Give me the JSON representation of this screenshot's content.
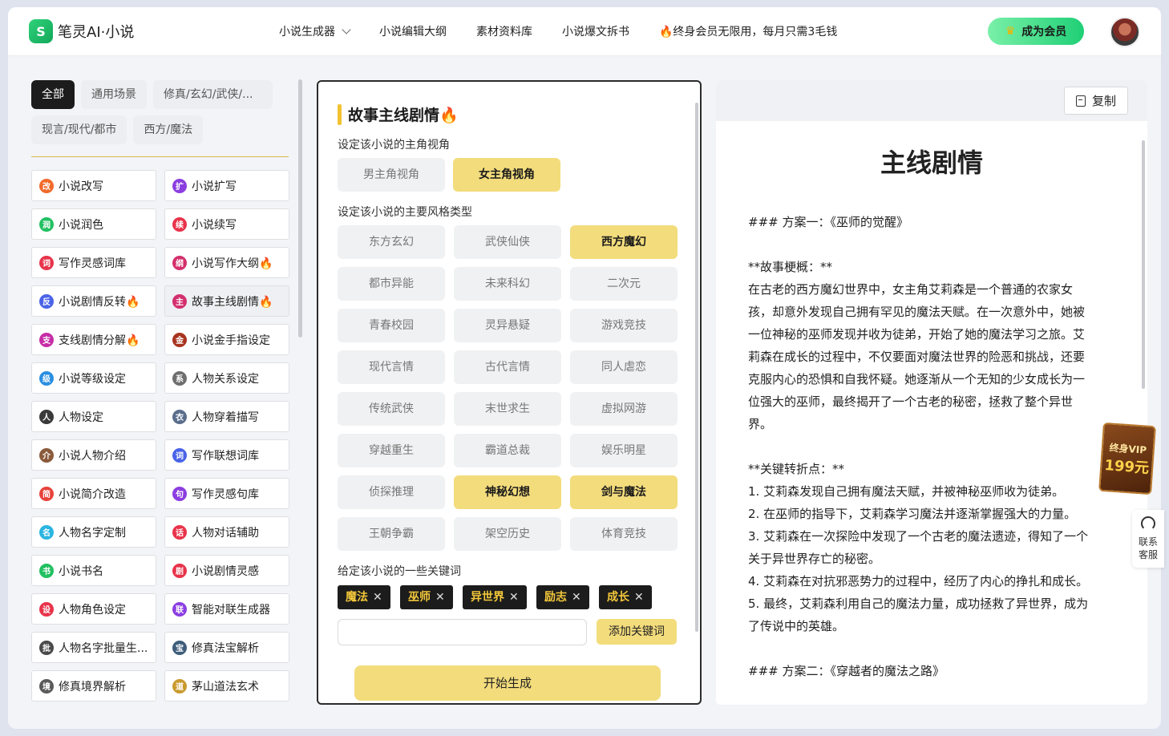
{
  "brand": {
    "name": "笔灵AI·小说",
    "mark": "S"
  },
  "nav": [
    {
      "label": "小说生成器",
      "has_dropdown": true
    },
    {
      "label": "小说编辑大纲"
    },
    {
      "label": "素材资料库"
    },
    {
      "label": "小说爆文拆书"
    },
    {
      "label": "🔥终身会员无限用，每月只需3毛钱"
    }
  ],
  "vip_button": {
    "label": "成为会员",
    "icon": "crown-icon"
  },
  "filters": {
    "row1": [
      "全部",
      "通用场景",
      "修真/玄幻/武侠/..."
    ],
    "row2": [
      "现言/现代/都市",
      "西方/魔法"
    ],
    "active": "全部"
  },
  "tools": [
    {
      "label": "小说改写",
      "icon": "改",
      "color": "#f06a2a"
    },
    {
      "label": "小说扩写",
      "icon": "扩",
      "color": "#8b3ee0"
    },
    {
      "label": "小说润色",
      "icon": "润",
      "color": "#22c061"
    },
    {
      "label": "小说续写",
      "icon": "续",
      "color": "#e8334a"
    },
    {
      "label": "写作灵感词库",
      "icon": "词",
      "color": "#e8334a"
    },
    {
      "label": "小说写作大纲🔥",
      "icon": "纲",
      "color": "#d4306b"
    },
    {
      "label": "小说剧情反转🔥",
      "icon": "反",
      "color": "#4a63e8"
    },
    {
      "label": "故事主线剧情🔥",
      "icon": "主",
      "color": "#d32f6f"
    },
    {
      "label": "支线剧情分解🔥",
      "icon": "支",
      "color": "#c62da6"
    },
    {
      "label": "小说金手指设定",
      "icon": "金",
      "color": "#a8341f"
    },
    {
      "label": "小说等级设定",
      "icon": "级",
      "color": "#2b8fe0"
    },
    {
      "label": "人物关系设定",
      "icon": "系",
      "color": "#6e6e6e"
    },
    {
      "label": "人物设定",
      "icon": "人",
      "color": "#3a3a3a"
    },
    {
      "label": "人物穿着描写",
      "icon": "衣",
      "color": "#5a6e8c"
    },
    {
      "label": "小说人物介绍",
      "icon": "介",
      "color": "#8a5a3a"
    },
    {
      "label": "写作联想词库",
      "icon": "词",
      "color": "#4a63e8"
    },
    {
      "label": "小说简介改造",
      "icon": "简",
      "color": "#e8433a"
    },
    {
      "label": "写作灵感句库",
      "icon": "句",
      "color": "#8b3ee0"
    },
    {
      "label": "人物名字定制",
      "icon": "名",
      "color": "#2bb5e0"
    },
    {
      "label": "人物对话辅助",
      "icon": "话",
      "color": "#e8334a"
    },
    {
      "label": "小说书名",
      "icon": "书",
      "color": "#22c061"
    },
    {
      "label": "小说剧情灵感",
      "icon": "剧",
      "color": "#e8334a"
    },
    {
      "label": "人物角色设定",
      "icon": "设",
      "color": "#e8334a"
    },
    {
      "label": "智能对联生成器",
      "icon": "联",
      "color": "#8b3ee0"
    },
    {
      "label": "人物名字批量生...",
      "icon": "批",
      "color": "#4a4a4a"
    },
    {
      "label": "修真法宝解析",
      "icon": "宝",
      "color": "#3d5d7a"
    },
    {
      "label": "修真境界解析",
      "icon": "境",
      "color": "#5a5a5a"
    },
    {
      "label": "茅山道法玄术",
      "icon": "道",
      "color": "#c99a2e"
    }
  ],
  "selected_tool": "故事主线剧情🔥",
  "panel": {
    "title": "故事主线剧情🔥",
    "pov_label": "设定该小说的主角视角",
    "pov_options": [
      "男主角视角",
      "女主角视角"
    ],
    "pov_selected": "女主角视角",
    "style_label": "设定该小说的主要风格类型",
    "styles": [
      "东方玄幻",
      "武侠仙侠",
      "西方魔幻",
      "都市异能",
      "未来科幻",
      "二次元",
      "青春校园",
      "灵异悬疑",
      "游戏竞技",
      "现代言情",
      "古代言情",
      "同人虐恋",
      "传统武侠",
      "末世求生",
      "虚拟网游",
      "穿越重生",
      "霸道总裁",
      "娱乐明星",
      "侦探推理",
      "神秘幻想",
      "剑与魔法",
      "王朝争霸",
      "架空历史",
      "体育竞技"
    ],
    "styles_selected": [
      "西方魔幻",
      "神秘幻想",
      "剑与魔法"
    ],
    "keyword_label": "给定该小说的一些关键词",
    "keywords": [
      "魔法",
      "巫师",
      "异世界",
      "励志",
      "成长"
    ],
    "keyword_input_placeholder": "",
    "add_keyword_label": "添加关键词",
    "generate_label": "开始生成"
  },
  "result": {
    "copy_label": "复制",
    "title": "主线剧情",
    "lines": [
      "### 方案一：《巫师的觉醒》",
      "",
      "**故事梗概：**",
      "在古老的西方魔幻世界中，女主角艾莉森是一个普通的农家女",
      "孩，却意外发现自己拥有罕见的魔法天赋。在一次意外中，她被",
      "一位神秘的巫师发现并收为徒弟，开始了她的魔法学习之旅。艾",
      "莉森在成长的过程中，不仅要面对魔法世界的险恶和挑战，还要",
      "克服内心的恐惧和自我怀疑。她逐渐从一个无知的少女成长为一",
      "位强大的巫师，最终揭开了一个古老的秘密，拯救了整个异世",
      "界。",
      "",
      "**关键转折点：**",
      "1. 艾莉森发现自己拥有魔法天赋，并被神秘巫师收为徒弟。",
      "2. 在巫师的指导下，艾莉森学习魔法并逐渐掌握强大的力量。",
      "3. 艾莉森在一次探险中发现了一个古老的魔法遗迹，得知了一个",
      "关于异世界存亡的秘密。",
      "4. 艾莉森在对抗邪恶势力的过程中，经历了内心的挣扎和成长。",
      "5. 最终，艾莉森利用自己的魔法力量，成功拯救了异世界，成为",
      "了传说中的英雄。",
      "",
      "### 方案二：《穿越者的魔法之路》"
    ]
  },
  "floating": {
    "vip_badge_line1": "终身VIP",
    "vip_badge_line2": "199元",
    "service_line1": "联系",
    "service_line2": "客服"
  }
}
